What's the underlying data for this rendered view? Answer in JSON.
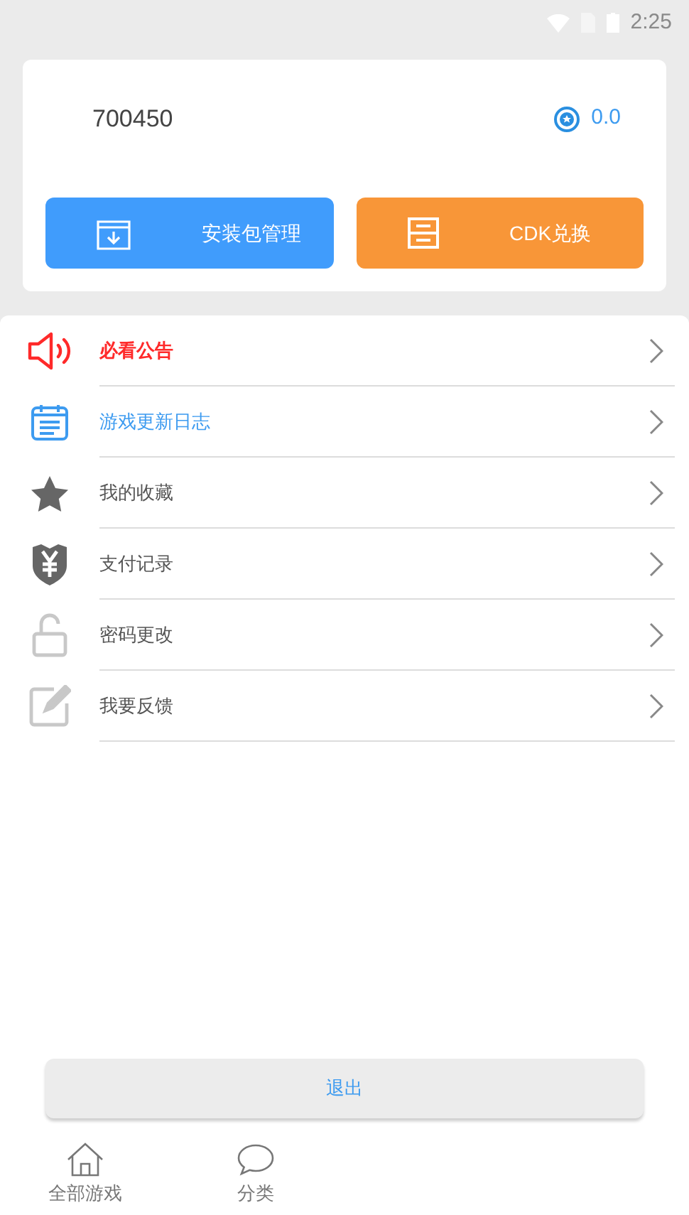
{
  "status_bar": {
    "time": "2:25"
  },
  "profile": {
    "username": "700450",
    "points": "0.0"
  },
  "actions": [
    {
      "kind": "package",
      "label": "安装包管理"
    },
    {
      "kind": "cdk",
      "label": "CDK兑换"
    }
  ],
  "menu": [
    {
      "kind": "announce",
      "label": "必看公告",
      "color": "#ff2a2a"
    },
    {
      "kind": "changelog",
      "label": "游戏更新日志",
      "color": "#3d9bf0"
    },
    {
      "kind": "favorite",
      "label": "我的收藏",
      "color": "#555555"
    },
    {
      "kind": "payment",
      "label": "支付记录",
      "color": "#555555"
    },
    {
      "kind": "password",
      "label": "密码更改",
      "color": "#555555"
    },
    {
      "kind": "feedback",
      "label": "我要反馈",
      "color": "#555555"
    }
  ],
  "logout": "退出",
  "bottom_nav": [
    {
      "kind": "home",
      "label": "全部游戏"
    },
    {
      "kind": "category",
      "label": "分类"
    }
  ]
}
